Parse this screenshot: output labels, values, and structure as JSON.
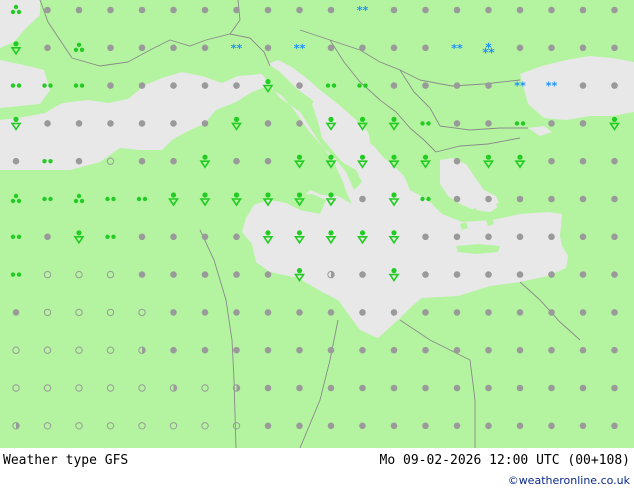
{
  "footer": {
    "title": "Weather type  GFS",
    "valid": "Mo 09-02-2026 12:00 UTC (00+108)",
    "credit": "©weatheronline.co.uk"
  },
  "colors": {
    "land": "#b4f4a0",
    "sea": "#e8e8e8",
    "border": "#8a8a8a",
    "symbol_grey": "#9a9a9a",
    "rain_green": "#22cc22",
    "snow_blue": "#1e90ff"
  },
  "grid_symbols": [
    "s31 d d d d d d d d d d s2 d d d d d d d d",
    "r d s31 d d d d s2 d s2 d d d d s2 s32 d d d d",
    "r2 r2 r2 d d d d d r d r2 r2 d d d d s2 s2 d d",
    "r d d d d d d r d d r r r r2 d d r2 d d r",
    "d r2 d c d d r d d r r r r r d r r d d d",
    "s3 r2 s3 r2 r2 r r r r r r d r r2 d d d d d d",
    "r2 d r r2 d d d d r r r r r d d d d d d d",
    "r2 c c c d d d d d r o d r d d d d d d d",
    "d c c c c d d d d d d d d d d d d d d d",
    "c c c c o d d d d d d d d d d d d d d d",
    "c c c c c o c o d d d d d d d d d d d d",
    "o c c c c c c c d d d d d d d d d d d d"
  ]
}
